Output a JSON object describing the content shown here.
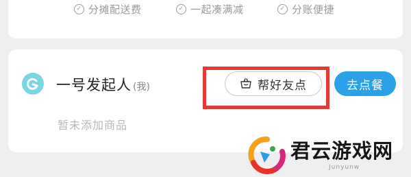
{
  "features": [
    {
      "label": "分摊配送费"
    },
    {
      "label": "一起凑满减"
    },
    {
      "label": "分账便捷"
    }
  ],
  "initiator": {
    "name": "一号发起人",
    "self_tag": "(我)",
    "empty_text": "暂未添加商品"
  },
  "actions": {
    "help_order": "帮好友点",
    "go_order": "去点餐"
  },
  "watermark": {
    "text": "君云游戏网",
    "sub": "Junyunw"
  },
  "colors": {
    "accent_blue": "#2aa1e8",
    "highlight_red": "#e53935",
    "avatar": "#7ad6e3"
  }
}
